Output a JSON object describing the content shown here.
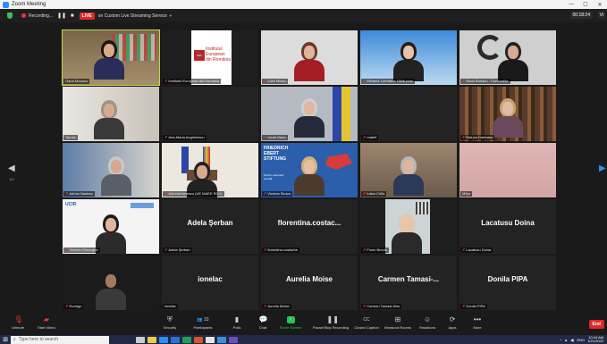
{
  "window": {
    "title": "Zoom Meeting",
    "minimize": "—",
    "maximize": "☐",
    "close": "✕"
  },
  "topbar": {
    "recording_label": "Recording...",
    "pause_icon": "❚❚",
    "stop_icon": "■",
    "live_label": "LIVE",
    "stream_label": "on Custom Live Streaming Service",
    "stream_chevron": "▼",
    "timer": "00:18:24",
    "view_label": "Vi"
  },
  "pager": {
    "left": "◀",
    "right": "▶",
    "page": "1/2"
  },
  "participants": [
    {
      "name": "Oana Mocanu",
      "muted": false,
      "active": true,
      "video": true,
      "scene": "woman-bookshelf"
    },
    {
      "name": "Institutul European din România",
      "muted": true,
      "video": true,
      "scene": "logo-ier",
      "logo_line1": "Institutul",
      "logo_line2": "European",
      "logo_line3": "din România",
      "logo_mark": "IER"
    },
    {
      "name": "Livia Minoiu",
      "muted": true,
      "video": true,
      "scene": "woman-red"
    },
    {
      "name": "Mihaela-Loredana Hărăuman",
      "muted": true,
      "video": true,
      "scene": "woman-blue"
    },
    {
      "name": "Radu Burlacu - Contondita",
      "muted": true,
      "video": true,
      "scene": "man-logo"
    },
    {
      "name": "Tamas",
      "muted": false,
      "video": true,
      "scene": "older-man"
    },
    {
      "name": "Ana-Maria Anghelescu",
      "muted": true,
      "video": false
    },
    {
      "name": "Iacob Baciu",
      "muted": true,
      "video": true,
      "scene": "man-suit-flags"
    },
    {
      "name": "mateif",
      "muted": true,
      "video": false
    },
    {
      "name": "Raluca Dreteanu",
      "muted": true,
      "video": true,
      "scene": "woman-glasses-books"
    },
    {
      "name": "Adrian Nasirau",
      "muted": true,
      "video": true,
      "scene": "man-grey"
    },
    {
      "name": "Antonia Ionescu (UE MAEE RCU)",
      "muted": true,
      "video": true,
      "scene": "flags-room"
    },
    {
      "name": "Victoria Stoica",
      "muted": true,
      "video": true,
      "scene": "fes-banner",
      "banner_line1": "FRIEDRICH",
      "banner_line2": "EBERT",
      "banner_line3": "STIFTUNG",
      "banner_sub": "Pentru o Europă socială"
    },
    {
      "name": "Iulian Chifu",
      "muted": true,
      "video": true,
      "scene": "man-glasses"
    },
    {
      "name": "MAyr",
      "muted": false,
      "video": true,
      "scene": "pink-blank"
    },
    {
      "name": "Victoria Gheorghe",
      "muted": true,
      "video": true,
      "scene": "woman-logos",
      "logo_text": "UCIR"
    },
    {
      "name": "Adela Şerban",
      "muted": true,
      "video": false,
      "display": "Adela Şerban"
    },
    {
      "name": "florentina.costache",
      "muted": true,
      "video": false,
      "display": "florentina.costac..."
    },
    {
      "name": "Florin Brecla",
      "muted": true,
      "video": true,
      "scene": "bald-man"
    },
    {
      "name": "Lacatusu Doina",
      "muted": true,
      "video": false,
      "display": "Lacatusu Doina"
    },
    {
      "name": "Rodrigo",
      "muted": true,
      "video": true,
      "scene": "man-dark"
    },
    {
      "name": "ionelac",
      "muted": false,
      "video": false,
      "display": "ionelac"
    },
    {
      "name": "Aurelia Moise",
      "muted": true,
      "video": false,
      "display": "Aurelia Moise"
    },
    {
      "name": "Carmen Tamasi-Kiss",
      "muted": true,
      "video": false,
      "display": "Carmen Tamasi-..."
    },
    {
      "name": "Donila PIPA",
      "muted": true,
      "video": false,
      "display": "Donila PIPA"
    }
  ],
  "toolbar": {
    "unmute": "Unmute",
    "start_video": "Start Video",
    "security": "Security",
    "participants": "Participants",
    "participants_count": "33",
    "polls": "Polls",
    "chat": "Chat",
    "share_screen": "Share Screen",
    "pause_recording": "Pause/Stop Recording",
    "closed_caption": "Closed Caption",
    "breakout_rooms": "Breakout Rooms",
    "reactions": "Reactions",
    "apps": "Apps",
    "more": "More",
    "end": "End"
  },
  "taskbar": {
    "search_placeholder": "Type here to search",
    "lang": "ENG",
    "time": "10:44 AM",
    "date": "1/21/2022"
  },
  "colors": {
    "active_speaker": "#b9dc4c",
    "mute_red": "#e33333",
    "live_red": "#e02828",
    "share_green": "#23c552"
  }
}
